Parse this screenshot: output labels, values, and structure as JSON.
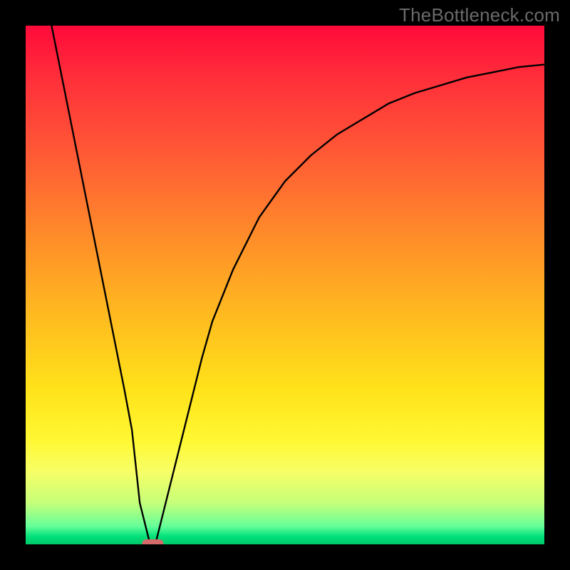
{
  "watermark": "TheBottleneck.com",
  "chart_data": {
    "type": "line",
    "title": "",
    "xlabel": "",
    "ylabel": "",
    "xlim": [
      0,
      100
    ],
    "ylim": [
      0,
      100
    ],
    "grid": false,
    "legend": false,
    "series": [
      {
        "name": "bottleneck-curve",
        "x": [
          5,
          8,
          12,
          16,
          19,
          20.5,
          22,
          24,
          25,
          26,
          27,
          28,
          30,
          32,
          34,
          36,
          40,
          45,
          50,
          55,
          60,
          65,
          70,
          75,
          80,
          85,
          90,
          95,
          100
        ],
        "y": [
          100,
          85,
          65,
          45,
          30,
          22,
          8,
          0,
          0,
          4,
          8,
          12,
          20,
          28,
          36,
          43,
          53,
          63,
          70,
          75,
          79,
          82,
          85,
          87,
          88.5,
          90,
          91,
          92,
          92.5
        ]
      }
    ],
    "marker": {
      "name": "optimal-point",
      "x": 24.5,
      "y": 0,
      "color": "#d46a6a"
    },
    "background_gradient": {
      "stops": [
        {
          "offset": 0.0,
          "color": "#ff0a3a"
        },
        {
          "offset": 0.1,
          "color": "#ff2e3a"
        },
        {
          "offset": 0.25,
          "color": "#ff5a35"
        },
        {
          "offset": 0.4,
          "color": "#ff8a2a"
        },
        {
          "offset": 0.55,
          "color": "#ffb820"
        },
        {
          "offset": 0.7,
          "color": "#ffe21a"
        },
        {
          "offset": 0.8,
          "color": "#fff833"
        },
        {
          "offset": 0.86,
          "color": "#f7ff66"
        },
        {
          "offset": 0.92,
          "color": "#c6ff7a"
        },
        {
          "offset": 0.965,
          "color": "#66ff99"
        },
        {
          "offset": 0.985,
          "color": "#00e07a"
        },
        {
          "offset": 1.0,
          "color": "#00c96b"
        }
      ]
    },
    "frame_color": "#000000",
    "frame_width_frac": 0.045
  }
}
